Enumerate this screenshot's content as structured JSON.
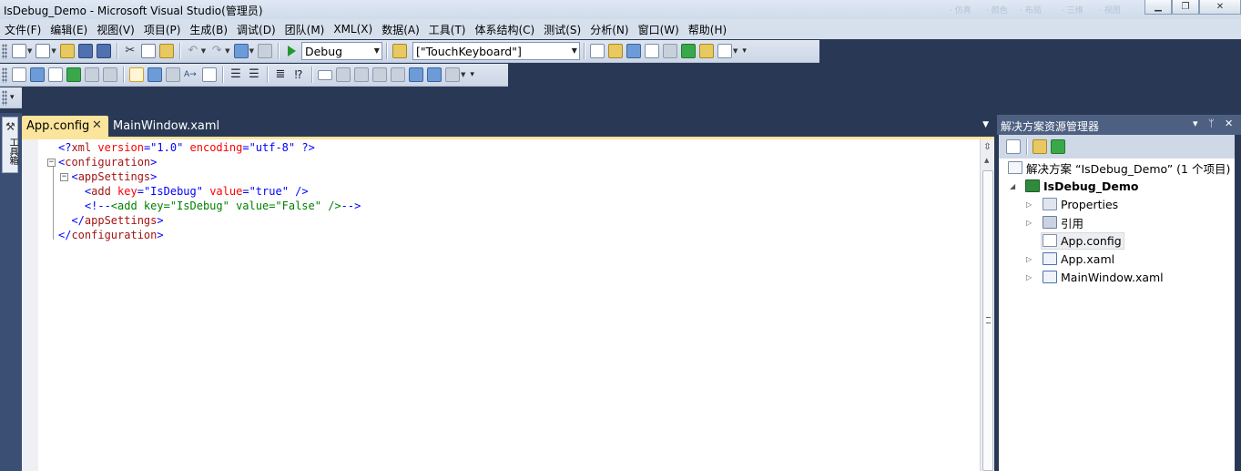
{
  "window": {
    "title": "IsDebug_Demo - Microsoft Visual Studio(管理员)",
    "ghost_labels": [
      "· 仿真",
      "· 颜色",
      "· 布局",
      "· 三维",
      "· 视图"
    ]
  },
  "menu": [
    "文件(F)",
    "编辑(E)",
    "视图(V)",
    "项目(P)",
    "生成(B)",
    "调试(D)",
    "团队(M)",
    "XML(X)",
    "数据(A)",
    "工具(T)",
    "体系结构(C)",
    "测试(S)",
    "分析(N)",
    "窗口(W)",
    "帮助(H)"
  ],
  "toolbar": {
    "config_value": "Debug",
    "find_value": "[\"TouchKeyboard\"]"
  },
  "toolbox": {
    "label": "工具箱"
  },
  "tabs": {
    "active": "App.config",
    "inactive": "MainWindow.xaml",
    "close_glyph": "✕"
  },
  "editor": {
    "lines": [
      {
        "parts": [
          [
            "blue",
            "<?"
          ],
          [
            "red",
            "xml"
          ],
          [
            "attr",
            " version"
          ],
          [
            "blue",
            "="
          ],
          [
            "val",
            "\"1.0\""
          ],
          [
            "attr",
            " encoding"
          ],
          [
            "blue",
            "="
          ],
          [
            "val",
            "\"utf-8\""
          ],
          [
            "blue",
            " ?>"
          ]
        ]
      },
      {
        "parts": [
          [
            "blue",
            "<"
          ],
          [
            "red",
            "configuration"
          ],
          [
            "blue",
            ">"
          ]
        ]
      },
      {
        "parts": [
          [
            "blue",
            "  <"
          ],
          [
            "red",
            "appSettings"
          ],
          [
            "blue",
            ">"
          ]
        ]
      },
      {
        "parts": [
          [
            "blue",
            "    <"
          ],
          [
            "red",
            "add"
          ],
          [
            "attr",
            " key"
          ],
          [
            "blue",
            "="
          ],
          [
            "val",
            "\"IsDebug\""
          ],
          [
            "attr",
            " value"
          ],
          [
            "blue",
            "="
          ],
          [
            "val",
            "\"true\""
          ],
          [
            "blue",
            " />"
          ]
        ]
      },
      {
        "parts": [
          [
            "blue",
            "    <!--"
          ],
          [
            "green",
            "<add key=\"IsDebug\" value=\"False\" />"
          ],
          [
            "blue",
            "-->"
          ]
        ]
      },
      {
        "parts": [
          [
            "blue",
            "  </"
          ],
          [
            "red",
            "appSettings"
          ],
          [
            "blue",
            ">"
          ]
        ]
      },
      {
        "parts": [
          [
            "blue",
            "</"
          ],
          [
            "red",
            "configuration"
          ],
          [
            "blue",
            ">"
          ]
        ]
      }
    ]
  },
  "solution_explorer": {
    "title": "解决方案资源管理器",
    "header_buttons": [
      "▾",
      "ᛘ",
      "✕"
    ],
    "solution": "解决方案 “IsDebug_Demo” (1 个项目)",
    "project": "IsDebug_Demo",
    "items": [
      "Properties",
      "引用",
      "App.config",
      "App.xaml",
      "MainWindow.xaml"
    ],
    "selected": "App.config"
  }
}
